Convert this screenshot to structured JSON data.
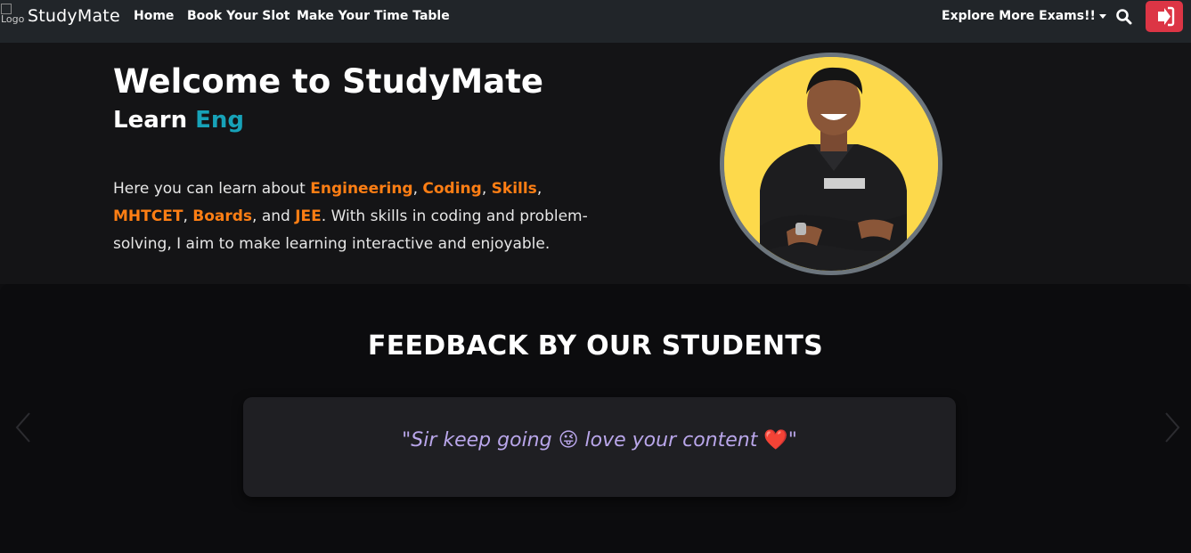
{
  "nav": {
    "logo_alt": "Logo",
    "brand": "StudyMate",
    "links": [
      "Home",
      "Book Your Slot",
      "Make Your Time Table"
    ],
    "explore": "Explore More Exams!!",
    "search_icon": "search-icon",
    "logout_icon": "sign-out-icon",
    "logout_color": "#dc3545"
  },
  "hero": {
    "title": "Welcome to StudyMate",
    "learn_prefix": "Learn",
    "learn_typed": "Eng",
    "intro": {
      "p1": "Here you can learn about ",
      "engineering": "Engineering",
      "c1": ", ",
      "coding": "Coding",
      "c2": ", ",
      "skills": "Skills",
      "c3": ",",
      "mhtcet": "MHTCET",
      "c4": ", ",
      "boards": "Boards",
      "c5": ", and ",
      "jee": "JEE",
      "p2": ". With skills in coding and problem-solving, I aim to make learning interactive and enjoyable."
    },
    "accent_color": "#17a2b8",
    "highlight_color": "#fd7e14"
  },
  "feedback": {
    "title": "FEEDBACK BY OUR STUDENTS",
    "quote_open": "\"Sir keep going ",
    "emoji1": "😜",
    "quote_mid": " love your content ",
    "emoji2": "❤️",
    "quote_close": "\""
  }
}
